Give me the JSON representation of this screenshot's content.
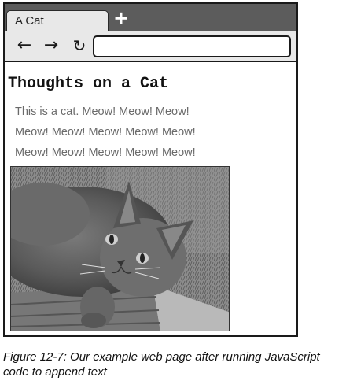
{
  "browser": {
    "tab_title": "A Cat",
    "new_tab_icon": "plus-icon",
    "nav": {
      "back_icon": "arrow-left-icon",
      "forward_icon": "arrow-right-icon",
      "reload_icon": "reload-icon"
    },
    "address_value": ""
  },
  "page": {
    "heading": "Thoughts on a Cat",
    "paragraph": "This is a cat. Meow! Meow! Meow! Meow! Meow! Meow! Meow! Meow! Meow! Meow! Meow! Meow! Meow!"
  },
  "caption": "Figure 12-7: Our example web page after running JavaScript code to append text"
}
